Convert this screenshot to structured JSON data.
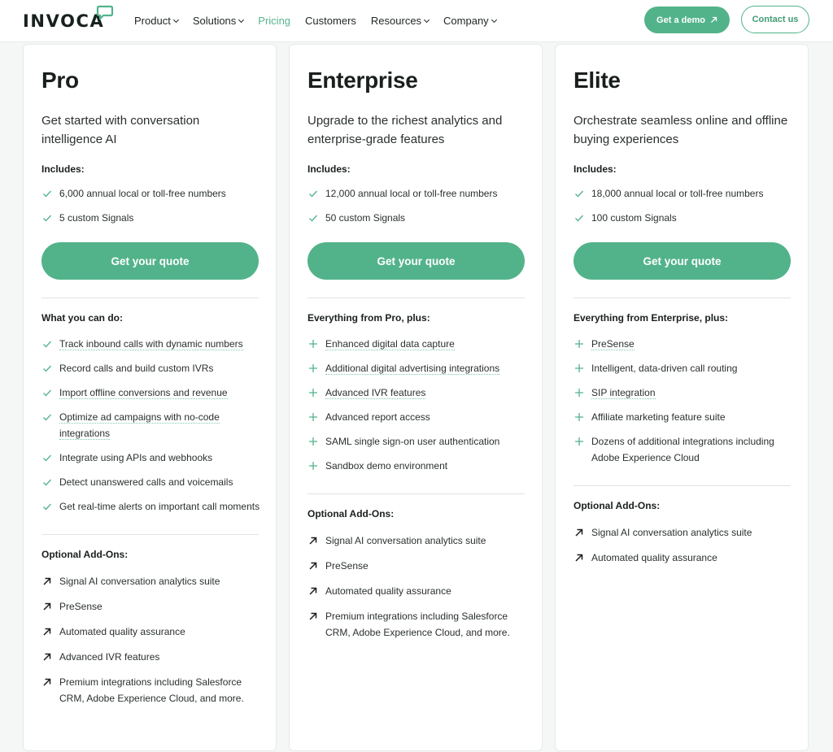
{
  "nav": {
    "logo": "INVOCA",
    "menu": [
      {
        "label": "Product",
        "dropdown": true
      },
      {
        "label": "Solutions",
        "dropdown": true
      },
      {
        "label": "Pricing",
        "dropdown": false,
        "active": true
      },
      {
        "label": "Customers",
        "dropdown": false
      },
      {
        "label": "Resources",
        "dropdown": true
      },
      {
        "label": "Company",
        "dropdown": true
      }
    ],
    "demo_label": "Get a demo",
    "contact_label": "Contact us"
  },
  "colors": {
    "accent": "#52b38a",
    "text": "#1f2523",
    "link_underline": "#7fcaa7"
  },
  "plans": [
    {
      "name": "Pro",
      "description": "Get started with conversation intelligence AI",
      "includes_label": "Includes:",
      "includes": [
        "6,000 annual local or toll-free numbers",
        "5 custom Signals"
      ],
      "cta": "Get your quote",
      "features_label": "What you can do:",
      "feature_icon": "check-icon",
      "features": [
        {
          "text": "Track inbound calls with dynamic numbers",
          "link": true
        },
        {
          "text": "Record calls and build custom IVRs",
          "link": false
        },
        {
          "text": "Import offline conversions and revenue",
          "link": true
        },
        {
          "text": "Optimize ad campaigns with no-code integrations",
          "link": true
        },
        {
          "text": "Integrate using APIs and webhooks",
          "link": false
        },
        {
          "text": "Detect unanswered calls and voicemails",
          "link": false
        },
        {
          "text": "Get real-time alerts on important call moments",
          "link": false
        }
      ],
      "addons_label": "Optional Add-Ons:",
      "addons": [
        "Signal AI conversation analytics suite",
        "PreSense",
        "Automated quality assurance",
        "Advanced IVR features",
        "Premium integrations including Salesforce CRM, Adobe Experience Cloud, and more."
      ]
    },
    {
      "name": "Enterprise",
      "description": "Upgrade to the richest analytics and enterprise-grade features",
      "includes_label": "Includes:",
      "includes": [
        "12,000 annual local or toll-free numbers",
        "50 custom Signals"
      ],
      "cta": "Get your quote",
      "features_label": "Everything from Pro, plus:",
      "feature_icon": "plus-icon",
      "features": [
        {
          "text": "Enhanced digital data capture",
          "link": true
        },
        {
          "text": "Additional digital advertising integrations",
          "link": true
        },
        {
          "text": "Advanced IVR features",
          "link": true
        },
        {
          "text": "Advanced report access",
          "link": false
        },
        {
          "text": "SAML single sign-on user authentication",
          "link": false
        },
        {
          "text": "Sandbox demo environment",
          "link": false
        }
      ],
      "addons_label": "Optional Add-Ons:",
      "addons": [
        "Signal AI conversation analytics suite",
        "PreSense",
        "Automated quality assurance",
        "Premium integrations including Salesforce CRM, Adobe Experience Cloud, and more."
      ]
    },
    {
      "name": "Elite",
      "description": "Orchestrate seamless online and offline buying experiences",
      "includes_label": "Includes:",
      "includes": [
        "18,000 annual local or toll-free numbers",
        "100 custom Signals"
      ],
      "cta": "Get your quote",
      "features_label": "Everything from Enterprise, plus:",
      "feature_icon": "plus-icon",
      "features": [
        {
          "text": "PreSense",
          "link": true
        },
        {
          "text": "Intelligent, data-driven call routing",
          "link": false
        },
        {
          "text": "SIP integration",
          "link": true
        },
        {
          "text": "Affiliate marketing feature suite",
          "link": false
        },
        {
          "text": "Dozens of additional integrations including Adobe Experience Cloud",
          "link": false
        }
      ],
      "addons_label": "Optional Add-Ons:",
      "addons": [
        "Signal AI conversation analytics suite",
        "Automated quality assurance"
      ]
    }
  ]
}
